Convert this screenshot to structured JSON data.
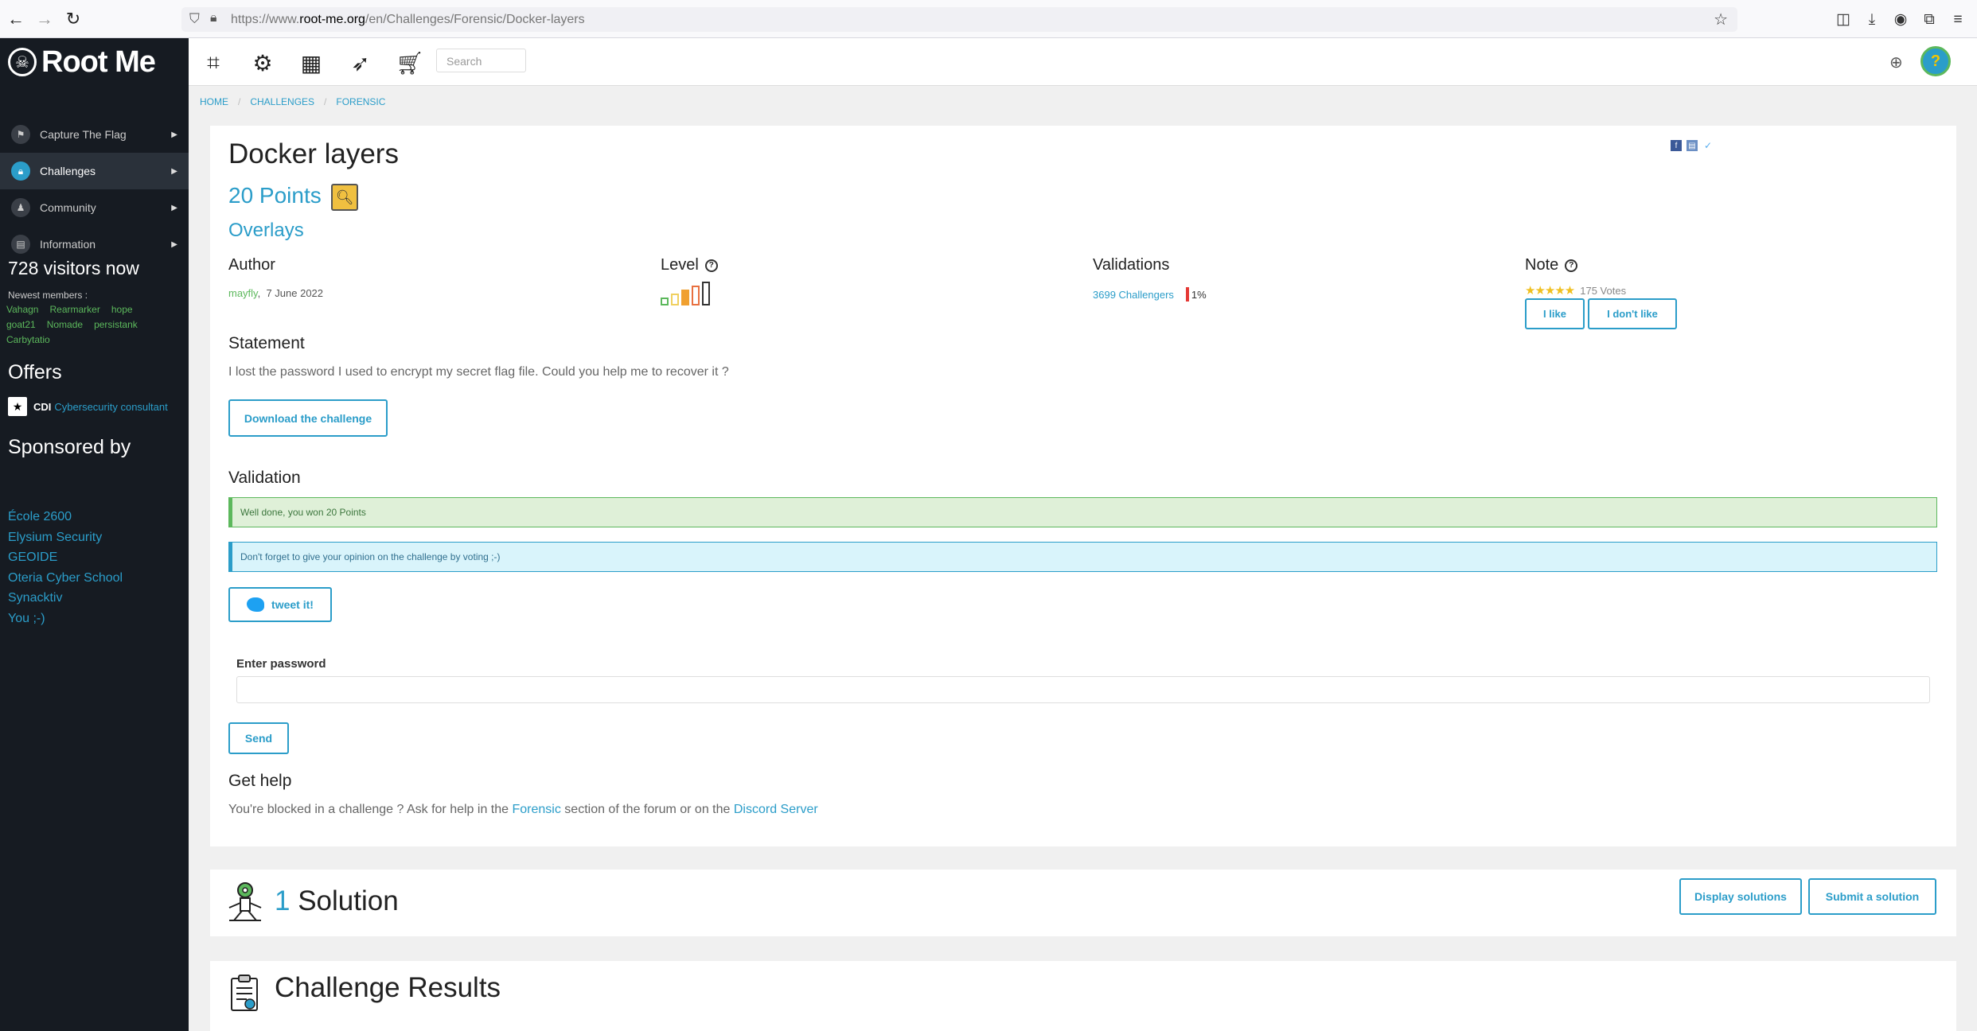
{
  "browser": {
    "url_prefix": "https://www.",
    "url_domain": "root-me.org",
    "url_path": "/en/Challenges/Forensic/Docker-layers"
  },
  "sidebar": {
    "logo_text": "Root Me",
    "items": [
      {
        "label": "Capture The Flag",
        "icon": "flag-icon"
      },
      {
        "label": "Challenges",
        "icon": "lock-icon"
      },
      {
        "label": "Community",
        "icon": "community-icon"
      },
      {
        "label": "Information",
        "icon": "book-icon"
      }
    ],
    "visitors": "728 visitors now",
    "newest_label": "Newest members :",
    "members": [
      "Vahagn",
      "Rearmarker",
      "hope",
      "goat21",
      "Nomade",
      "persistank",
      "Carbytatio"
    ],
    "offers_heading": "Offers",
    "offer": {
      "type": "CDI",
      "title": "Cybersecurity consultant"
    },
    "sponsored_heading": "Sponsored by",
    "sponsors": [
      "École 2600",
      "Elysium Security",
      "GEOIDE",
      "Oteria Cyber School",
      "Synacktiv",
      "You ;-)"
    ]
  },
  "header": {
    "search_placeholder": "Search"
  },
  "breadcrumb": [
    "HOME",
    "CHALLENGES",
    "FORENSIC"
  ],
  "challenge": {
    "title": "Docker layers",
    "points": "20 Points",
    "category": "Overlays",
    "author_heading": "Author",
    "author_name": "mayfly",
    "author_date": "7 June 2022",
    "level_heading": "Level",
    "level": 2,
    "level_max": 5,
    "validations_heading": "Validations",
    "challengers": "3699 Challengers",
    "validation_percent": "1%",
    "note_heading": "Note",
    "rating_stars": 5,
    "votes": "175 Votes",
    "like_label": "I like",
    "dislike_label": "I don't like",
    "statement_heading": "Statement",
    "statement": "I lost the password I used to encrypt my secret flag file. Could you help me to recover it ?",
    "download_label": "Download the challenge",
    "validation_heading": "Validation",
    "success_msg": "Well done, you won 20 Points",
    "info_msg": "Don't forget to give your opinion on the challenge by voting ;-)",
    "tweet_label": "tweet it!",
    "password_label": "Enter password",
    "send_label": "Send",
    "help_heading": "Get help",
    "help_before": "You're blocked in a challenge ? Ask for help in the ",
    "help_link_forum": "Forensic",
    "help_middle": " section of the forum or on the ",
    "help_link_discord": "Discord Server"
  },
  "solutions": {
    "count": "1",
    "label": " Solution",
    "display_label": "Display solutions",
    "submit_label": "Submit a solution"
  },
  "results": {
    "title": "Challenge Results"
  },
  "colors": {
    "accent": "#2b9dc9",
    "sidebar_bg": "#161b22",
    "success": "#5cb85c"
  }
}
